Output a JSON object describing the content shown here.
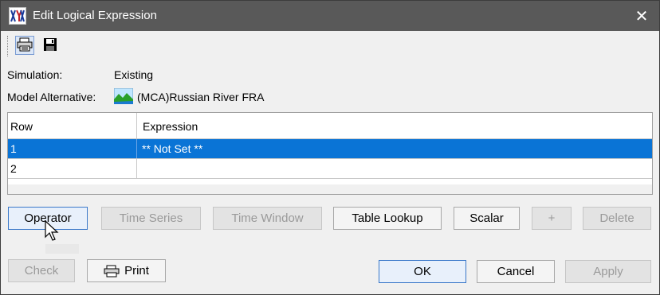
{
  "window": {
    "title": "Edit Logical Expression",
    "close_glyph": "✕"
  },
  "toolbar": {
    "print_icon": "printer-icon",
    "save_icon": "floppy-disk-icon"
  },
  "info": {
    "simulation_label": "Simulation:",
    "simulation_value": "Existing",
    "model_alt_label": "Model Alternative:",
    "model_alt_value": "(MCA)Russian River FRA",
    "model_alt_icon": "landscape-icon"
  },
  "table": {
    "headers": [
      "Row",
      "Expression"
    ],
    "rows": [
      {
        "row": "1",
        "expression": "** Not Set **",
        "selected": true
      },
      {
        "row": "2",
        "expression": "",
        "selected": false
      }
    ]
  },
  "buttons": {
    "operator": "Operator",
    "time_series": "Time Series",
    "time_window": "Time Window",
    "table_lookup": "Table Lookup",
    "scalar": "Scalar",
    "plus": "+",
    "delete": "Delete",
    "check": "Check",
    "print": "Print",
    "ok": "OK",
    "cancel": "Cancel",
    "apply": "Apply"
  },
  "colors": {
    "titlebar": "#595959",
    "selection": "#0a74d6",
    "focus_border": "#3a78c9"
  }
}
